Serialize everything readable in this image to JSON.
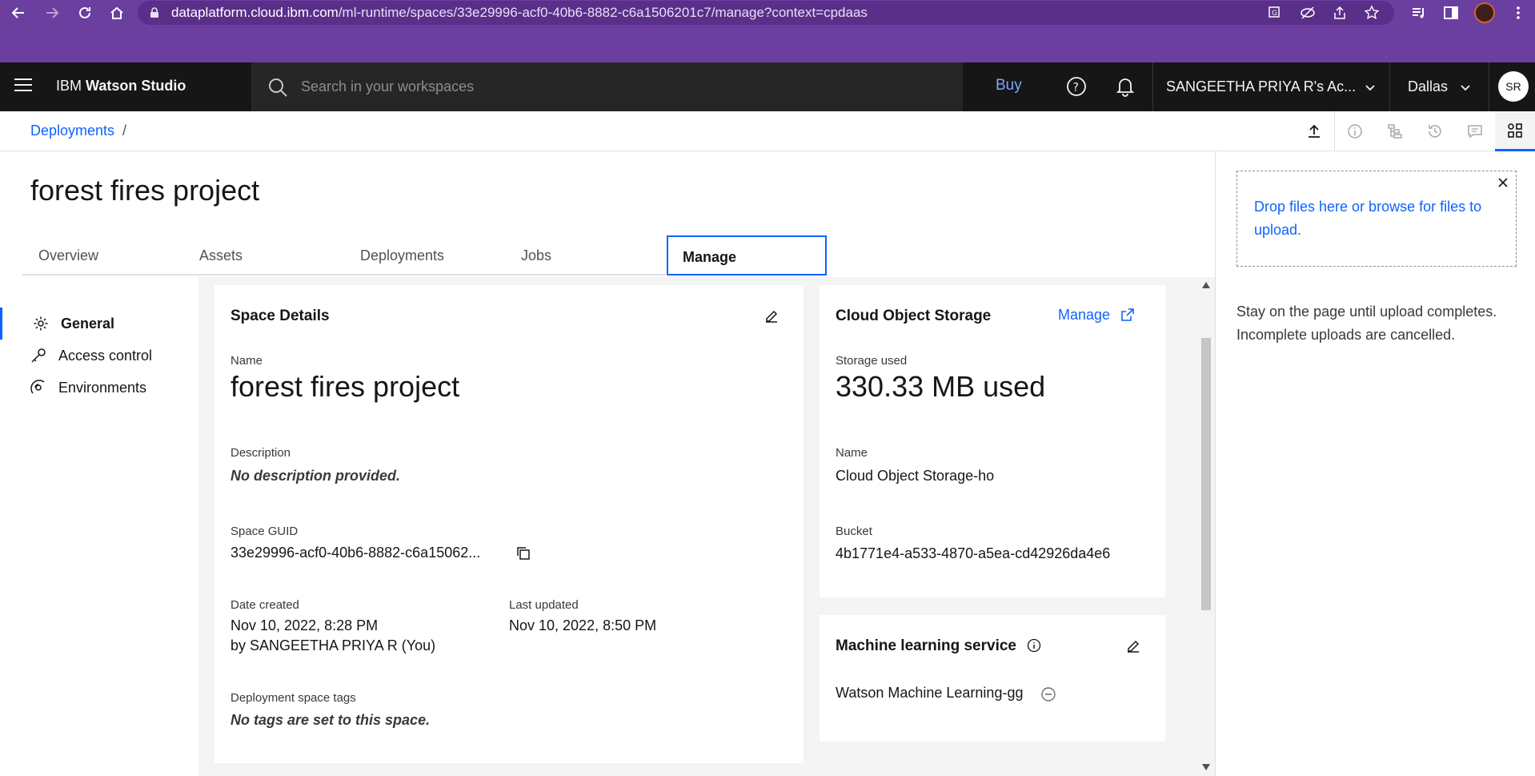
{
  "browser": {
    "url_host": "dataplatform.cloud.ibm.com",
    "url_path": "/ml-runtime/spaces/33e29996-acf0-40b6-8882-c6a1506201c7/manage?context=cpdaas"
  },
  "header": {
    "brand_prefix": "IBM",
    "brand_name": "Watson Studio",
    "search_placeholder": "Search in your workspaces",
    "buy_label": "Buy",
    "account_label": "SANGEETHA PRIYA R's Ac...",
    "region_label": "Dallas",
    "avatar_initials": "SR"
  },
  "breadcrumb": {
    "root": "Deployments",
    "separator": "/"
  },
  "page": {
    "title": "forest fires project"
  },
  "tabs": [
    {
      "label": "Overview"
    },
    {
      "label": "Assets"
    },
    {
      "label": "Deployments"
    },
    {
      "label": "Jobs"
    },
    {
      "label": "Manage"
    }
  ],
  "sidenav": {
    "items": [
      {
        "label": "General"
      },
      {
        "label": "Access control"
      },
      {
        "label": "Environments"
      }
    ]
  },
  "space_details": {
    "heading": "Space Details",
    "name_label": "Name",
    "name_value": "forest fires project",
    "description_label": "Description",
    "description_value": "No description provided.",
    "guid_label": "Space GUID",
    "guid_value": "33e29996-acf0-40b6-8882-c6a15062...",
    "date_created_label": "Date created",
    "date_created_value": "Nov 10, 2022, 8:28 PM",
    "created_by": "by SANGEETHA PRIYA R (You)",
    "last_updated_label": "Last updated",
    "last_updated_value": "Nov 10, 2022, 8:50 PM",
    "tags_label": "Deployment space tags",
    "tags_value": "No tags are set to this space."
  },
  "cos": {
    "heading": "Cloud Object Storage",
    "manage_label": "Manage",
    "storage_label": "Storage used",
    "storage_value": "330.33 MB used",
    "name_label": "Name",
    "name_value": "Cloud Object Storage-ho",
    "bucket_label": "Bucket",
    "bucket_value": "4b1771e4-a533-4870-a5ea-cd42926da4e6"
  },
  "ml_service": {
    "heading": "Machine learning service",
    "service_name": "Watson Machine Learning-gg"
  },
  "upload_panel": {
    "dropzone_text": "Drop files here or browse for files to upload.",
    "note": "Stay on the page until upload completes. Incomplete uploads are cancelled."
  },
  "colors": {
    "browser_frame": "#6b3fa0",
    "app_header": "#161616",
    "accent": "#0f62fe",
    "content_bg": "#f4f4f4"
  }
}
